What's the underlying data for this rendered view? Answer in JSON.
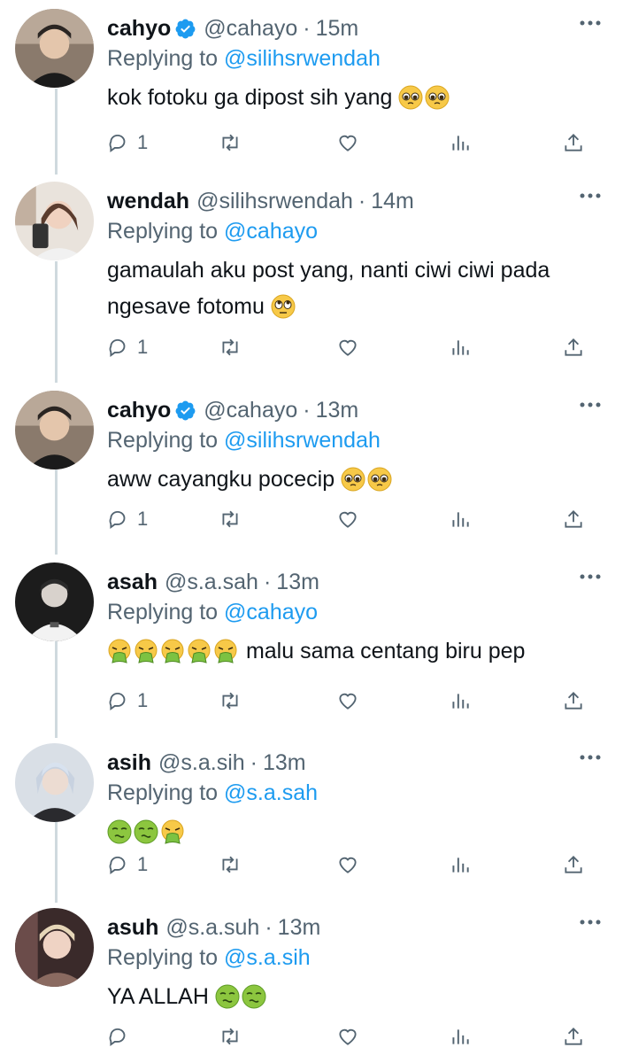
{
  "tweets": [
    {
      "name": "cahyo",
      "verified": true,
      "handle": "@cahayo",
      "time": "15m",
      "replying_label": "Replying to",
      "replying_to": "@silihsrwendah",
      "text": "kok fotoku ga dipost sih yang",
      "emojis": [
        "pleading-face",
        "pleading-face"
      ],
      "reply_count": "1"
    },
    {
      "name": "wendah",
      "verified": false,
      "handle": "@silihsrwendah",
      "time": "14m",
      "replying_label": "Replying to",
      "replying_to": "@cahayo",
      "text": "gamaulah aku post yang, nanti ciwi ciwi pada ngesave fotomu",
      "emojis": [
        "eye-roll-face"
      ],
      "reply_count": "1"
    },
    {
      "name": "cahyo",
      "verified": true,
      "handle": "@cahayo",
      "time": "13m",
      "replying_label": "Replying to",
      "replying_to": "@silihsrwendah",
      "text": "aww cayangku pocecip",
      "emojis": [
        "pleading-face",
        "pleading-face"
      ],
      "reply_count": "1"
    },
    {
      "name": "asah",
      "verified": false,
      "handle": "@s.a.sah",
      "time": "13m",
      "replying_label": "Replying to",
      "replying_to": "@cahayo",
      "text": "malu sama centang biru pep",
      "emojis_before": [
        "vomit-face",
        "vomit-face",
        "vomit-face",
        "vomit-face",
        "vomit-face"
      ],
      "reply_count": "1"
    },
    {
      "name": "asih",
      "verified": false,
      "handle": "@s.a.sih",
      "time": "13m",
      "replying_label": "Replying to",
      "replying_to": "@s.a.sah",
      "text": "",
      "emojis": [
        "nauseated-face",
        "nauseated-face",
        "vomit-face"
      ],
      "reply_count": "1"
    },
    {
      "name": "asuh",
      "verified": false,
      "handle": "@s.a.suh",
      "time": "13m",
      "replying_label": "Replying to",
      "replying_to": "@s.a.sih",
      "text": "YA ALLAH",
      "emojis": [
        "nauseated-face",
        "nauseated-face"
      ],
      "reply_count": ""
    }
  ],
  "colors": {
    "accent": "#1d9bf0",
    "muted": "#536471",
    "text": "#0f1419",
    "thread_line": "#cfd9de"
  }
}
